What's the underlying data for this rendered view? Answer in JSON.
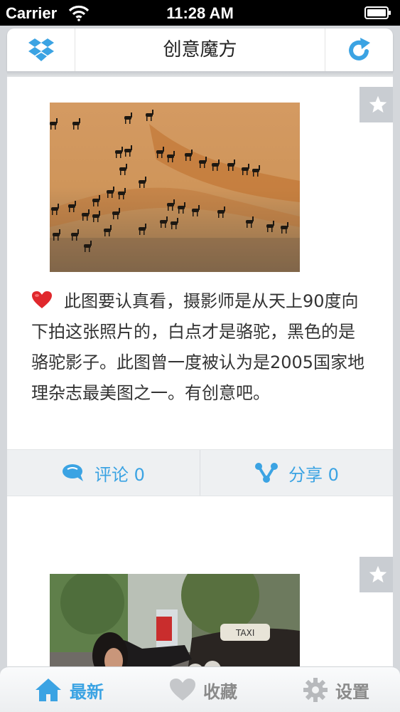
{
  "status_bar": {
    "carrier": "Carrier",
    "time": "11:28 AM"
  },
  "nav": {
    "title": "创意魔方",
    "left_icon": "dropbox-icon",
    "right_icon": "refresh-icon"
  },
  "feed": [
    {
      "image": "camel-desert-photo",
      "text": "此图要认真看，摄影师是从天上90度向下拍这张照片的，白点才是骆驼，黑色的是骆驼影子。此图曾一度被认为是2005国家地理杂志最美图之一。有创意吧。",
      "comment_label": "评论 0",
      "share_label": "分享 0"
    },
    {
      "image": "woman-tuktuk-photo"
    }
  ],
  "tabs": [
    {
      "label": "最新",
      "icon": "home-icon",
      "active": true
    },
    {
      "label": "收藏",
      "icon": "heart-icon",
      "active": false
    },
    {
      "label": "设置",
      "icon": "gear-icon",
      "active": false
    }
  ],
  "colors": {
    "accent": "#3ba3e3",
    "inactive": "#8a8a8a",
    "heart": "#e0282d"
  }
}
